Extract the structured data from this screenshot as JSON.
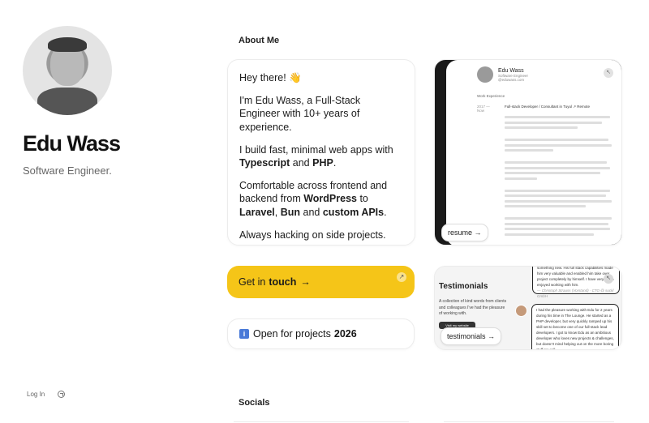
{
  "profile": {
    "name": "Edu Wass",
    "role": "Software Engineer."
  },
  "footer": {
    "login_label": "Log In"
  },
  "about": {
    "heading": "About Me",
    "greeting": "Hey there! 👋",
    "intro": "I'm Edu Wass, a Full-Stack Engineer with 10+ years of experience.",
    "line2_pre": "I build fast, minimal web apps with ",
    "line2_tech1": "Typescript",
    "line2_mid": " and ",
    "line2_tech2": "PHP",
    "line2_end": ".",
    "line3_pre": "Comfortable across frontend and backend from ",
    "line3_tech1": "WordPress",
    "line3_mid1": " to ",
    "line3_tech2": "Laravel",
    "line3_sep": ", ",
    "line3_tech3": "Bun",
    "line3_mid2": " and ",
    "line3_tech4": "custom APIs",
    "line3_end": ".",
    "line4": "Always hacking on side projects."
  },
  "cta": {
    "touch_pre": "Get in",
    "touch_bold": "touch",
    "touch_arrow": "→",
    "projects_pre": "Open for projects",
    "projects_year": "2026",
    "info_glyph": "i"
  },
  "resume": {
    "name": "Edu Wass",
    "title": "Software Engineer",
    "contact": "@eduwass.com",
    "section": "Work Experience",
    "date": "2017 — Now",
    "job": "Full-stack Developer / Consultant in Tuyul ↗ Remote",
    "pill": "resume →"
  },
  "testimonials": {
    "title": "Testimonials",
    "desc": "A collection of kind words from clients and colleagues I've had the pleasure of working with.",
    "visit": "Visit my website",
    "quote1": "something new. His full stack capabilities made him very valuable and enabled him take over project completely by himself. I have very much enjoyed working with him.",
    "quote1_author": "— Christoph Strauss (Vorstand) · CTO @ suckl GmbH",
    "quote2": "I had the pleasure working with Edu for 2 years during his time in The Lounge. He started as a PHP developer, but very quickly ramped up his skill set to become one of our full-stack lead developers. I got to know Edu as an ambitious developer who loves new projects & challenges, but doesn't mind helping out on the more boring stuff as well.",
    "pill": "testimonials →"
  },
  "socials": {
    "heading": "Socials"
  },
  "icons": {
    "arrow_up_right": "↗",
    "expand": "↖"
  },
  "colors": {
    "accent_yellow": "#f5c518",
    "info_blue": "#4a7ad8"
  }
}
